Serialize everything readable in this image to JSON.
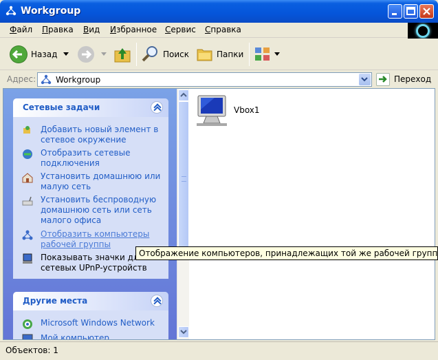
{
  "window": {
    "title": "Workgroup"
  },
  "menu": {
    "items": [
      "Файл",
      "Правка",
      "Вид",
      "Избранное",
      "Сервис",
      "Справка"
    ]
  },
  "toolbar": {
    "back_label": "Назад",
    "search_label": "Поиск",
    "folders_label": "Папки"
  },
  "address": {
    "label": "Адрес:",
    "value": "Workgroup",
    "go_label": "Переход"
  },
  "network_tasks": {
    "title": "Сетевые задачи",
    "items": [
      {
        "line1": "Добавить новый элемент в",
        "line2": "сетевое окружение",
        "line3": ""
      },
      {
        "line1": "Отобразить сетевые",
        "line2": "подключения",
        "line3": ""
      },
      {
        "line1": "Установить домашнюю или",
        "line2": "малую сеть",
        "line3": ""
      },
      {
        "line1": "Установить беспроводную",
        "line2": "домашнюю сеть или сеть",
        "line3": "малого офиса"
      },
      {
        "line1": "Отобразить компьютеры",
        "line2": "рабочей группы",
        "line3": ""
      },
      {
        "line1": "Показывать значки для",
        "line2": "сетевых UPnP-устройств",
        "line3": ""
      }
    ]
  },
  "other_places": {
    "title": "Другие места",
    "items": [
      "Microsoft Windows Network",
      "Мой компьютер"
    ]
  },
  "content": {
    "items": [
      {
        "label": "Vbox1"
      }
    ]
  },
  "tooltip": {
    "text": "Отображение компьютеров, принадлежащих той же рабочей группе, что и"
  },
  "status": {
    "text": "Объектов: 1"
  },
  "colors": {
    "title_bar": "#0555DA",
    "task_link": "#215DC6",
    "pane_bg": "#7BA2E7"
  }
}
